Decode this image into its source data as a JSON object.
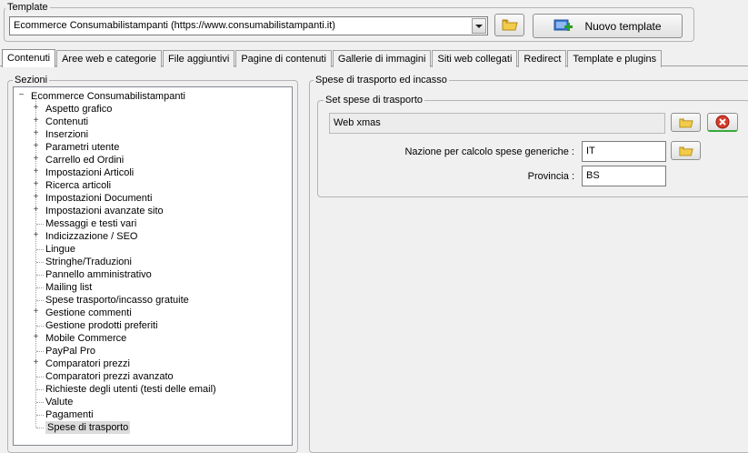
{
  "template": {
    "group_title": "Template",
    "selected": "Ecommerce Consumabilistampanti (https://www.consumabilistampanti.it)",
    "new_button": "Nuovo template"
  },
  "tabs": [
    {
      "label": "Contenuti"
    },
    {
      "label": "Aree web e categorie"
    },
    {
      "label": "File aggiuntivi"
    },
    {
      "label": "Pagine di contenuti"
    },
    {
      "label": "Gallerie di immagini"
    },
    {
      "label": "Siti web collegati"
    },
    {
      "label": "Redirect"
    },
    {
      "label": "Template e plugins"
    }
  ],
  "sections": {
    "title": "Sezioni",
    "root": "Ecommerce Consumabilistampanti",
    "items": [
      {
        "label": "Aspetto grafico",
        "expandable": true
      },
      {
        "label": "Contenuti",
        "expandable": true
      },
      {
        "label": "Inserzioni",
        "expandable": true
      },
      {
        "label": "Parametri utente",
        "expandable": true
      },
      {
        "label": "Carrello ed Ordini",
        "expandable": true
      },
      {
        "label": "Impostazioni Articoli",
        "expandable": true
      },
      {
        "label": "Ricerca articoli",
        "expandable": true
      },
      {
        "label": "Impostazioni Documenti",
        "expandable": true
      },
      {
        "label": "Impostazioni avanzate sito",
        "expandable": true
      },
      {
        "label": "Messaggi e testi vari",
        "expandable": false
      },
      {
        "label": "Indicizzazione / SEO",
        "expandable": true
      },
      {
        "label": "Lingue",
        "expandable": false
      },
      {
        "label": "Stringhe/Traduzioni",
        "expandable": false
      },
      {
        "label": "Pannello amministrativo",
        "expandable": false
      },
      {
        "label": "Mailing list",
        "expandable": false
      },
      {
        "label": "Spese trasporto/incasso gratuite",
        "expandable": false
      },
      {
        "label": "Gestione commenti",
        "expandable": true
      },
      {
        "label": "Gestione prodotti preferiti",
        "expandable": false
      },
      {
        "label": "Mobile Commerce",
        "expandable": true
      },
      {
        "label": "PayPal Pro",
        "expandable": false
      },
      {
        "label": "Comparatori prezzi",
        "expandable": true
      },
      {
        "label": "Comparatori prezzi avanzato",
        "expandable": false
      },
      {
        "label": "Richieste degli utenti (testi delle email)",
        "expandable": false
      },
      {
        "label": "Valute",
        "expandable": false
      },
      {
        "label": "Pagamenti",
        "expandable": false
      },
      {
        "label": "Spese di trasporto",
        "expandable": false,
        "selected": true
      }
    ]
  },
  "shipping": {
    "outer_title": "Spese di trasporto ed incasso",
    "inner_title": "Set spese di trasporto",
    "set_value": "Web xmas",
    "nation_label": "Nazione per calcolo spese generiche :",
    "nation_value": "IT",
    "province_label": "Provincia :",
    "province_value": "BS"
  }
}
